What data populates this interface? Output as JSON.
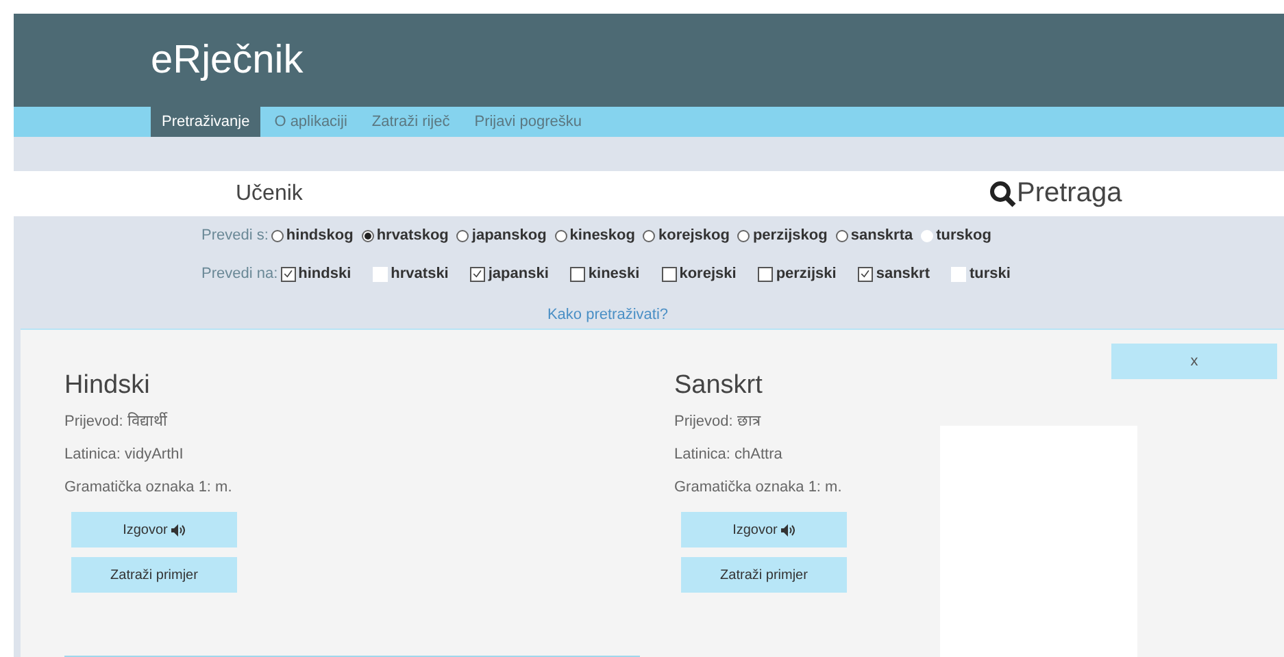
{
  "header": {
    "title": "eRječnik"
  },
  "nav": [
    {
      "label": "Pretraživanje",
      "selected": true
    },
    {
      "label": "O aplikaciji",
      "selected": false
    },
    {
      "label": "Zatraži riječ",
      "selected": false
    },
    {
      "label": "Prijavi pogrešku",
      "selected": false
    }
  ],
  "search": {
    "value": "Učenik",
    "button": "Pretraga"
  },
  "from": {
    "label": "Prevedi s:",
    "options": [
      {
        "label": "hindskog",
        "selected": false,
        "disabled": false
      },
      {
        "label": "hrvatskog",
        "selected": true,
        "disabled": false
      },
      {
        "label": "japanskog",
        "selected": false,
        "disabled": false
      },
      {
        "label": "kineskog",
        "selected": false,
        "disabled": false
      },
      {
        "label": "korejskog",
        "selected": false,
        "disabled": false
      },
      {
        "label": "perzijskog",
        "selected": false,
        "disabled": false
      },
      {
        "label": "sanskrta",
        "selected": false,
        "disabled": false
      },
      {
        "label": "turskog",
        "selected": false,
        "disabled": true
      }
    ]
  },
  "to": {
    "label": "Prevedi na:",
    "options": [
      {
        "label": "hindski",
        "checked": true,
        "disabled": false
      },
      {
        "label": "hrvatski",
        "checked": false,
        "disabled": true
      },
      {
        "label": "japanski",
        "checked": true,
        "disabled": false
      },
      {
        "label": "kineski",
        "checked": false,
        "disabled": false
      },
      {
        "label": "korejski",
        "checked": false,
        "disabled": false
      },
      {
        "label": "perzijski",
        "checked": false,
        "disabled": false
      },
      {
        "label": "sanskrt",
        "checked": true,
        "disabled": false
      },
      {
        "label": "turski",
        "checked": false,
        "disabled": true
      }
    ]
  },
  "help_link": "Kako pretraživati?",
  "results": {
    "close": "x",
    "entries": [
      {
        "language": "Hindski",
        "translation": "Prijevod: विद्यार्थी",
        "latin": "Latinica: vidyArthI",
        "grammar": "Gramatička oznaka 1: m.",
        "pronounce": "Izgovor",
        "example": "Zatraži primjer"
      },
      {
        "language": "Sanskrt",
        "translation": "Prijevod: छात्र",
        "latin": "Latinica: chAttra",
        "grammar": "Gramatička oznaka 1: m.",
        "pronounce": "Izgovor",
        "example": "Zatraži primjer"
      }
    ]
  }
}
